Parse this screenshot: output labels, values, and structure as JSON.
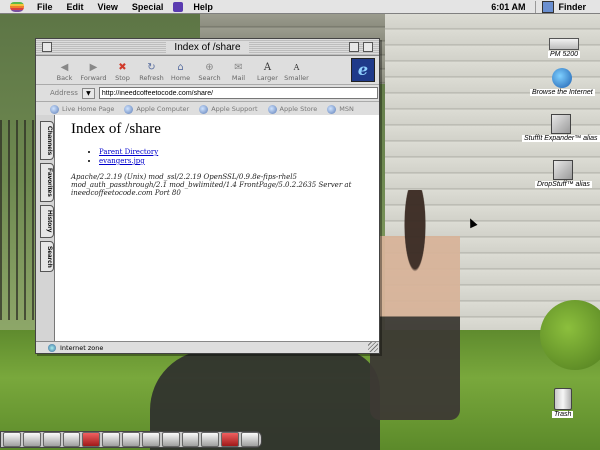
{
  "menubar": {
    "items": [
      "File",
      "Edit",
      "View",
      "Special",
      "Help"
    ],
    "clock": "6:01 AM",
    "app": "Finder"
  },
  "desktop_icons": [
    {
      "label": "PM 5200",
      "icon": "hard-disk-icon"
    },
    {
      "label": "Browse the Internet",
      "icon": "globe-icon"
    },
    {
      "label": "StuffIt Expander™ alias",
      "icon": "stuffit-icon"
    },
    {
      "label": "DropStuff™ alias",
      "icon": "dropstuff-icon"
    },
    {
      "label": "Trash",
      "icon": "trash-icon"
    }
  ],
  "browser": {
    "title": "Index of /share",
    "toolbar": [
      "Back",
      "Forward",
      "Stop",
      "Refresh",
      "Home",
      "Search",
      "Mail",
      "Larger",
      "Smaller"
    ],
    "address_label": "Address",
    "address": "http://ineedcoffeetocode.com/share/",
    "favorites": [
      "Live Home Page",
      "Apple Computer",
      "Apple Support",
      "Apple Store",
      "MSN"
    ],
    "side_tabs": [
      "Channels",
      "Favorites",
      "History",
      "Search"
    ],
    "page": {
      "heading": "Index of /share",
      "links": [
        "Parent Directory",
        "evangers.jpg"
      ],
      "server_line": "Apache/2.2.19 (Unix) mod_ssl/2.2.19 OpenSSL/0.9.8e-fips-rhel5 mod_auth_passthrough/2.1 mod_bwlimited/1.4 FrontPage/5.0.2.2635 Server at ineedcoffeetocode.com Port 80"
    },
    "status": "Internet zone"
  }
}
